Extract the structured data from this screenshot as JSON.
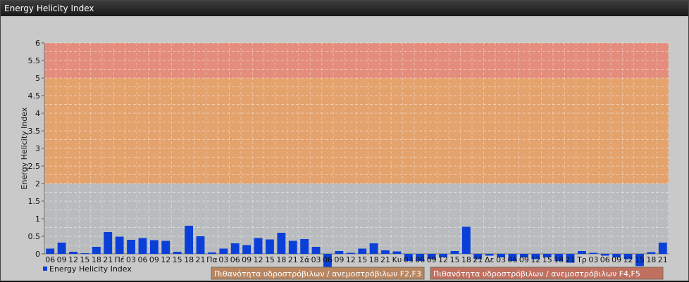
{
  "window": {
    "title": "Energy Helicity Index"
  },
  "legend": {
    "series_label": "Energy Helicity Index"
  },
  "bands": [
    {
      "label": "Πιθανότητα υδροστρόβιλων / ανεμοστρόβιλων F2,F3",
      "from": 2,
      "to": 5,
      "color": "#e6a068"
    },
    {
      "label": "Πιθανότητα υδροστρόβιλων / ανεμοστρόβιλων F4,F5",
      "from": 5,
      "to": 6,
      "color": "#e68a78"
    }
  ],
  "colors": {
    "bar": "#0a3fd8",
    "band_low": "#b9bcbe"
  },
  "chart_data": {
    "type": "bar",
    "title": "",
    "ylabel": "Energy Helicity Index",
    "ylim": [
      0,
      6
    ],
    "yticks": [
      "0",
      "0.5",
      "1",
      "1.5",
      "2",
      "2.5",
      "3",
      "3.5",
      "4",
      "4.5",
      "5",
      "5.5",
      "6"
    ],
    "categories": [
      "06",
      "09",
      "12",
      "15",
      "18",
      "21",
      "Πέ",
      "03",
      "06",
      "09",
      "12",
      "15",
      "18",
      "21",
      "Πα",
      "03",
      "06",
      "09",
      "12",
      "15",
      "18",
      "21",
      "Σά",
      "03",
      "06",
      "09",
      "12",
      "15",
      "18",
      "21",
      "Κυ",
      "03",
      "06",
      "09",
      "12",
      "15",
      "18",
      "21",
      "Δε",
      "03",
      "06",
      "09",
      "12",
      "15",
      "18",
      "21",
      "Τρ",
      "03",
      "06",
      "09",
      "12",
      "15",
      "18",
      "21"
    ],
    "values": [
      0.15,
      0.32,
      0.06,
      0.02,
      0.2,
      0.62,
      0.49,
      0.4,
      0.45,
      0.39,
      0.37,
      0.06,
      0.8,
      0.5,
      0.04,
      0.15,
      0.3,
      0.25,
      0.45,
      0.41,
      0.6,
      0.37,
      0.42,
      0.2,
      -0.45,
      0.08,
      0.03,
      0.15,
      0.3,
      0.1,
      0.07,
      -0.2,
      -0.2,
      -0.15,
      -0.1,
      0.08,
      0.77,
      -0.15,
      -0.05,
      -0.1,
      -0.2,
      -0.1,
      -0.15,
      -0.1,
      -0.2,
      -0.25,
      0.08,
      0.03,
      -0.05,
      -0.1,
      -0.15,
      -0.35,
      0.05,
      0.32
    ],
    "series": [
      {
        "name": "Energy Helicity Index"
      }
    ]
  }
}
